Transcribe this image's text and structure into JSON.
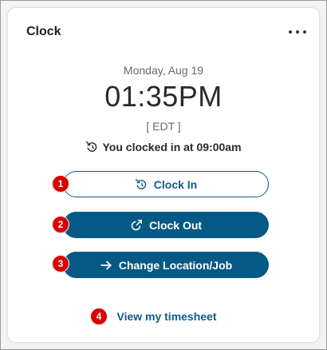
{
  "card": {
    "title": "Clock",
    "menu_icon": "more-horizontal-icon"
  },
  "clock": {
    "date": "Monday, Aug 19",
    "time": "01:35PM",
    "timezone": "[ EDT ]",
    "status_text": "You clocked in at 09:00am",
    "status_icon": "clock-in-icon"
  },
  "buttons": {
    "clock_in": {
      "label": "Clock In",
      "icon": "clock-in-icon",
      "badge": "1"
    },
    "clock_out": {
      "label": "Clock Out",
      "icon": "external-link-icon",
      "badge": "2"
    },
    "change_location": {
      "label": "Change Location/Job",
      "icon": "arrow-right-icon",
      "badge": "3"
    }
  },
  "timesheet_link": {
    "label": "View my timesheet",
    "badge": "4"
  },
  "colors": {
    "primary": "#075985",
    "badge": "#d80000",
    "text": "#2a2a2a",
    "muted": "#6a6a6a"
  }
}
